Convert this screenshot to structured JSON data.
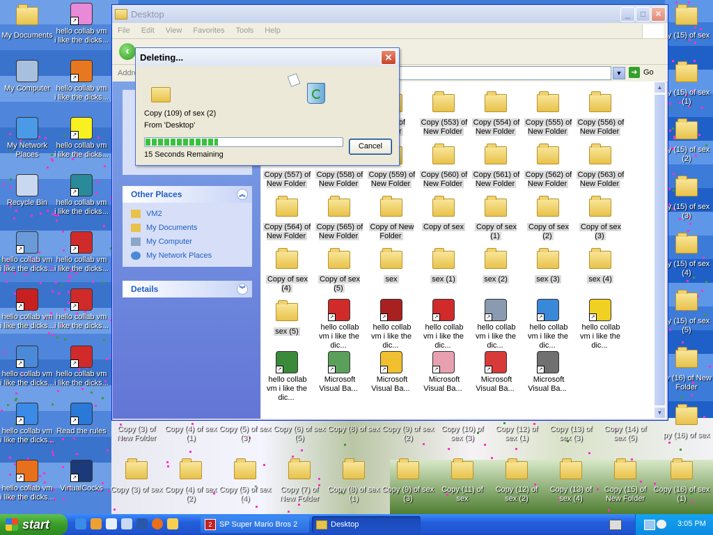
{
  "desktop": {
    "left_icons": [
      {
        "label": "My Documents",
        "icon": "folder-documents-icon",
        "shortcut": false
      },
      {
        "label": "hello collab vm i like the dicks...",
        "icon": "rainbow-app-icon",
        "shortcut": true
      },
      {
        "label": "My Computer",
        "icon": "computer-icon",
        "shortcut": false
      },
      {
        "label": "hello collab vm i like the dicks...",
        "icon": "loop-app-icon",
        "shortcut": true
      },
      {
        "label": "My Network Places",
        "icon": "network-icon",
        "shortcut": false
      },
      {
        "label": "hello collab vm i like the dicks...",
        "icon": "hand-icon",
        "shortcut": true
      },
      {
        "label": "Recycle Bin",
        "icon": "recycle-bin-icon",
        "shortcut": false
      },
      {
        "label": "hello collab vm i like the dicks...",
        "icon": "cube-app-icon",
        "shortcut": true
      },
      {
        "label": "hello collab vm i like the dicks...",
        "icon": "film-icon",
        "shortcut": true
      },
      {
        "label": "hello collab vm i like the dicks...",
        "icon": "mario-icon",
        "shortcut": true
      },
      {
        "label": "hello collab vm i like the dicks...",
        "icon": "nch-icon",
        "shortcut": true
      },
      {
        "label": "hello collab vm i like the dicks...",
        "icon": "mario-icon",
        "shortcut": true
      },
      {
        "label": "hello collab vm i like the dicks...",
        "icon": "qb-icon",
        "shortcut": true
      },
      {
        "label": "hello collab vm i like the dicks...",
        "icon": "mario-icon",
        "shortcut": true
      },
      {
        "label": "hello collab vm i like the dicks...",
        "icon": "quicktime-icon",
        "shortcut": true
      },
      {
        "label": "Read the rules",
        "icon": "teamviewer-icon",
        "shortcut": true
      },
      {
        "label": "hello collab vm i like the dicks...",
        "icon": "firefox-icon",
        "shortcut": true
      },
      {
        "label": "VirtualCocks",
        "icon": "virtualbox-icon",
        "shortcut": true
      }
    ],
    "right_icons": [
      "py (15) of sex",
      "py (15) of sex (1)",
      "py (15) of sex (2)",
      "py (15) of sex (3)",
      "py (15) of sex (4)",
      "py (15) of sex (5)",
      "py (16) of New Folder",
      "py (16) of sex"
    ],
    "bottom_row_1": [
      "Copy (3) of New Folder",
      "Copy (4) of sex (1)",
      "Copy (5) of sex (3)",
      "Copy (6) of sex (5)",
      "Copy (8) of sex",
      "Copy (9) of sex (2)",
      "Copy (10) of sex (3)",
      "Copy (12) of sex (1)",
      "Copy (13) of sex (3)",
      "Copy (14) of sex (5)"
    ],
    "bottom_row_2": [
      "Copy (3) of sex",
      "Copy (4) of sex (2)",
      "Copy (5) of sex (4)",
      "Copy (7) of New Folder",
      "Copy (8) of sex (1)",
      "Copy (9) of sex (3)",
      "Copy (11) of sex",
      "Copy (12) of sex (2)",
      "Copy (13) of sex (4)",
      "Copy (15) of New Folder",
      "Copy (16) of sex (1)"
    ]
  },
  "explorer": {
    "title": "Desktop",
    "menus": [
      "File",
      "Edit",
      "View",
      "Favorites",
      "Tools",
      "Help"
    ],
    "address_label": "Addre",
    "go_label": "Go",
    "other_places": {
      "title": "Other Places",
      "items": [
        "VM2",
        "My Documents",
        "My Computer",
        "My Network Places"
      ]
    },
    "details_title": "Details",
    "files": [
      {
        "label": "(552) of Folder",
        "type": "folder"
      },
      {
        "label": "Copy (553) of New Folder",
        "type": "folder"
      },
      {
        "label": "Copy (554) of New Folder",
        "type": "folder"
      },
      {
        "label": "Copy (555) of New Folder",
        "type": "folder"
      },
      {
        "label": "Copy (556) of New Folder",
        "type": "folder"
      },
      {
        "label": "Copy (557) of New Folder",
        "type": "folder"
      },
      {
        "label": "Copy (558) of New Folder",
        "type": "folder"
      },
      {
        "label": "Copy (559) of New Folder",
        "type": "folder"
      },
      {
        "label": "Copy (560) of New Folder",
        "type": "folder"
      },
      {
        "label": "Copy (561) of New Folder",
        "type": "folder"
      },
      {
        "label": "Copy (562) of New Folder",
        "type": "folder"
      },
      {
        "label": "Copy (563) of New Folder",
        "type": "folder"
      },
      {
        "label": "Copy (564) of New Folder",
        "type": "folder"
      },
      {
        "label": "Copy (565) of New Folder",
        "type": "folder"
      },
      {
        "label": "Copy of New Folder",
        "type": "folder"
      },
      {
        "label": "Copy of sex",
        "type": "folder"
      },
      {
        "label": "Copy of sex (1)",
        "type": "folder"
      },
      {
        "label": "Copy of sex (2)",
        "type": "folder"
      },
      {
        "label": "Copy of sex (3)",
        "type": "folder"
      },
      {
        "label": "Copy of sex (4)",
        "type": "folder"
      },
      {
        "label": "Copy of sex (5)",
        "type": "folder"
      },
      {
        "label": "sex",
        "type": "folder"
      },
      {
        "label": "sex (1)",
        "type": "folder"
      },
      {
        "label": "sex (2)",
        "type": "folder"
      },
      {
        "label": "sex (3)",
        "type": "folder"
      },
      {
        "label": "sex (4)",
        "type": "folder"
      },
      {
        "label": "sex (5)",
        "type": "folder"
      },
      {
        "label": "hello collab vm i like the dic...",
        "type": "mario-icon"
      },
      {
        "label": "hello collab vm i like the dic...",
        "type": "shield-app-icon"
      },
      {
        "label": "hello collab vm i like the dic...",
        "type": "mario-icon"
      },
      {
        "label": "hello collab vm i like the dic...",
        "type": "orb-app-icon"
      },
      {
        "label": "hello collab vm i like the dic...",
        "type": "boxes-app-icon"
      },
      {
        "label": "hello collab vm i like the dic...",
        "type": "sm2-icon"
      },
      {
        "label": "hello collab vm i like the dic...",
        "type": "ball-app-icon"
      },
      {
        "label": "Microsoft Visual Ba...",
        "type": "vb-icon"
      },
      {
        "label": "Microsoft Visual Ba...",
        "type": "disc-icon"
      },
      {
        "label": "Microsoft Visual Ba...",
        "type": "spiral-icon"
      },
      {
        "label": "Microsoft Visual Ba...",
        "type": "blocks-icon"
      },
      {
        "label": "Microsoft Visual Ba...",
        "type": "raccoon-icon"
      }
    ]
  },
  "dialog": {
    "title": "Deleting...",
    "file_line": "Copy (109) of sex (2)",
    "from_line": "From 'Desktop'",
    "progress": 0.37,
    "remaining": "15 Seconds Remaining",
    "cancel_label": "Cancel"
  },
  "taskbar": {
    "start_label": "start",
    "tasks": [
      {
        "label": "SP Super Mario Bros 2",
        "active": false
      },
      {
        "label": "Desktop",
        "active": true
      }
    ],
    "clock": "3:05 PM"
  },
  "colors": {
    "xp_blue": "#245edb",
    "start_green": "#3a9c2a",
    "progress_green": "#39c23e",
    "task_link": "#215dc6"
  }
}
